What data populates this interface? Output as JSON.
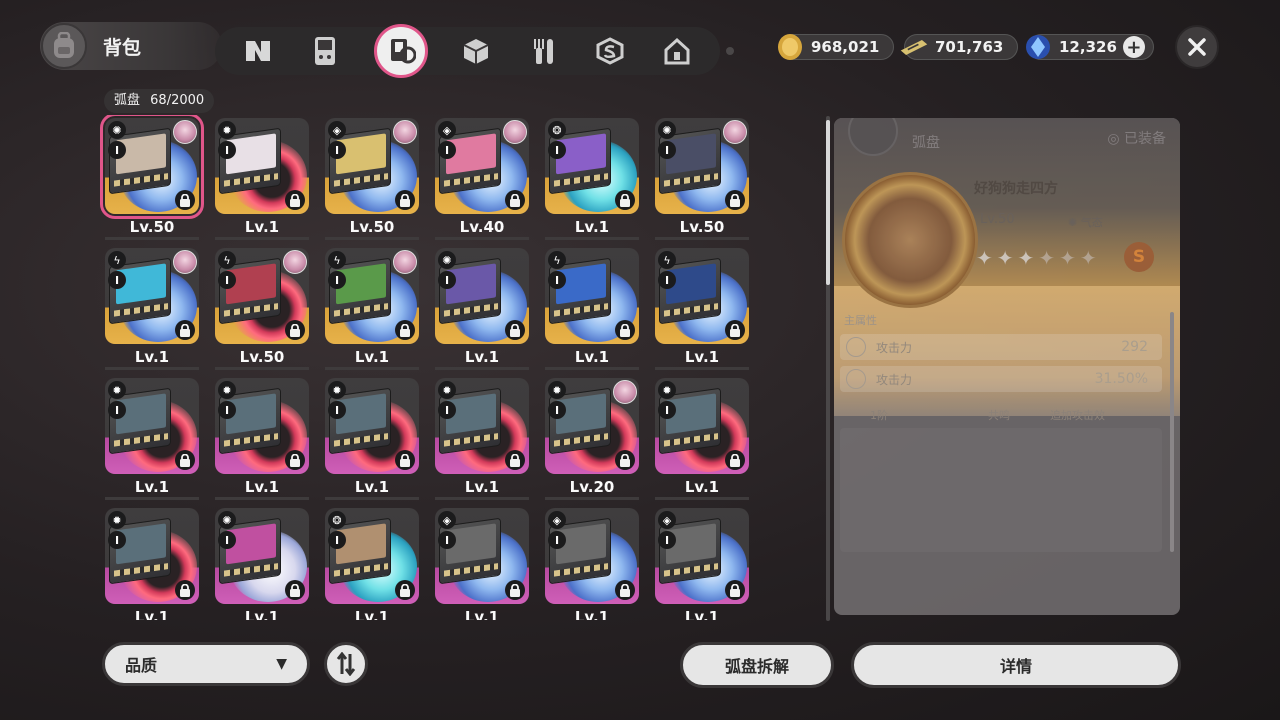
{
  "header": {
    "title": "背包",
    "tabs": [
      {
        "icon": "n-logo-icon"
      },
      {
        "icon": "handheld-console-icon"
      },
      {
        "icon": "disc-case-icon",
        "active": true
      },
      {
        "icon": "cube-icon"
      },
      {
        "icon": "fork-knife-icon"
      },
      {
        "icon": "shield-s-icon"
      },
      {
        "icon": "home-icon"
      }
    ],
    "currencies": [
      {
        "icon": "gold-coin-icon",
        "value": "968,021"
      },
      {
        "icon": "ticket-icon",
        "value": "701,763"
      },
      {
        "icon": "blue-crystal-icon",
        "value": "12,326"
      }
    ]
  },
  "inventory": {
    "label": "弧盘",
    "count": "68/2000",
    "items": [
      {
        "level": "Lv.50",
        "quality": "gold",
        "swirl": "blue",
        "rank": "I",
        "attr": "✺",
        "avatar": true,
        "selected": true,
        "art": "#c9b9a8"
      },
      {
        "level": "Lv.1",
        "quality": "gold",
        "swirl": "red",
        "rank": "I",
        "attr": "✹",
        "avatar": false,
        "art": "#e8e0e6"
      },
      {
        "level": "Lv.50",
        "quality": "gold",
        "swirl": "blue",
        "rank": "I",
        "attr": "◈",
        "avatar": true,
        "art": "#d9c070"
      },
      {
        "level": "Lv.40",
        "quality": "gold",
        "swirl": "blue",
        "rank": "I",
        "attr": "◈",
        "avatar": true,
        "art": "#e07aa0"
      },
      {
        "level": "Lv.1",
        "quality": "gold",
        "swirl": "teal",
        "rank": "I",
        "attr": "❂",
        "avatar": false,
        "art": "#8a5fc8"
      },
      {
        "level": "Lv.50",
        "quality": "gold",
        "swirl": "blue",
        "rank": "I",
        "attr": "✺",
        "avatar": true,
        "art": "#4a4e66"
      },
      {
        "level": "Lv.1",
        "quality": "gold",
        "swirl": "blue",
        "rank": "I",
        "attr": "ϟ",
        "avatar": true,
        "art": "#40b8d8"
      },
      {
        "level": "Lv.50",
        "quality": "gold",
        "swirl": "red",
        "rank": "I",
        "attr": "ϟ",
        "avatar": true,
        "art": "#b04050"
      },
      {
        "level": "Lv.1",
        "quality": "gold",
        "swirl": "blue",
        "rank": "I",
        "attr": "ϟ",
        "avatar": true,
        "art": "#5a9a4a"
      },
      {
        "level": "Lv.1",
        "quality": "gold",
        "swirl": "blue",
        "rank": "I",
        "attr": "✺",
        "avatar": false,
        "art": "#6a58a8"
      },
      {
        "level": "Lv.1",
        "quality": "gold",
        "swirl": "blue",
        "rank": "I",
        "attr": "ϟ",
        "avatar": false,
        "art": "#3a6ac8"
      },
      {
        "level": "Lv.1",
        "quality": "gold",
        "swirl": "blue",
        "rank": "I",
        "attr": "ϟ",
        "avatar": false,
        "art": "#2e4a8a"
      },
      {
        "level": "Lv.1",
        "quality": "purple",
        "swirl": "red",
        "rank": "I",
        "attr": "✹",
        "avatar": false,
        "art": "#5a6f7a"
      },
      {
        "level": "Lv.1",
        "quality": "purple",
        "swirl": "red",
        "rank": "I",
        "attr": "✹",
        "avatar": false,
        "art": "#5a6f7a"
      },
      {
        "level": "Lv.1",
        "quality": "purple",
        "swirl": "red",
        "rank": "I",
        "attr": "✹",
        "avatar": false,
        "art": "#5a6f7a"
      },
      {
        "level": "Lv.1",
        "quality": "purple",
        "swirl": "red",
        "rank": "I",
        "attr": "✹",
        "avatar": false,
        "art": "#5a6f7a"
      },
      {
        "level": "Lv.20",
        "quality": "purple",
        "swirl": "red",
        "rank": "I",
        "attr": "✹",
        "avatar": true,
        "art": "#5a6f7a"
      },
      {
        "level": "Lv.1",
        "quality": "purple",
        "swirl": "red",
        "rank": "I",
        "attr": "✹",
        "avatar": false,
        "art": "#5a6f7a"
      },
      {
        "level": "Lv.1",
        "quality": "purple",
        "swirl": "red",
        "rank": "I",
        "attr": "✹",
        "avatar": false,
        "art": "#5a6f7a"
      },
      {
        "level": "Lv.1",
        "quality": "purple",
        "swirl": "white",
        "rank": "I",
        "attr": "✺",
        "avatar": false,
        "art": "#c050a0"
      },
      {
        "level": "Lv.1",
        "quality": "purple",
        "swirl": "teal",
        "rank": "I",
        "attr": "❂",
        "avatar": false,
        "art": "#b09070"
      },
      {
        "level": "Lv.1",
        "quality": "purple",
        "swirl": "blue",
        "rank": "I",
        "attr": "◈",
        "avatar": false,
        "art": "#6a6a6a"
      },
      {
        "level": "Lv.1",
        "quality": "purple",
        "swirl": "blue",
        "rank": "I",
        "attr": "◈",
        "avatar": false,
        "art": "#6a6a6a"
      },
      {
        "level": "Lv.1",
        "quality": "purple",
        "swirl": "blue",
        "rank": "I",
        "attr": "◈",
        "avatar": false,
        "art": "#6a6a6a"
      }
    ]
  },
  "detail": {
    "section_title": "弧盘",
    "equipped_label": "已装备",
    "name": "好狗狗走四方",
    "level": "Lv.50",
    "type": "气态",
    "stars_filled": 3,
    "stars_total": 6,
    "rank_badge": "S",
    "main_attr_label": "主属性",
    "stats": [
      {
        "label": "攻击力",
        "value": "292"
      },
      {
        "label": "攻击力",
        "value": "31.50%"
      }
    ],
    "set_row": {
      "left": "1阶",
      "mid": "共鸣",
      "right": "追加攻击效"
    }
  },
  "bottom": {
    "quality_label": "品质",
    "dismantle_label": "弧盘拆解",
    "details_label": "详情"
  },
  "colors": {
    "accent_pink": "#e0568a",
    "gold_quality": "#e7b24a",
    "purple_quality": "#cf5fb8"
  }
}
